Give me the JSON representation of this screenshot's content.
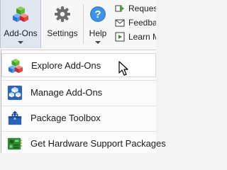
{
  "ribbon": {
    "addons_label": "Add-Ons",
    "settings_label": "Settings",
    "help_label": "Help",
    "small_items": [
      {
        "label": "Request",
        "icon": "request-support-icon"
      },
      {
        "label": "Feedback",
        "icon": "feedback-icon"
      },
      {
        "label": "Learn MATLAB",
        "icon": "learn-matlab-icon"
      }
    ]
  },
  "menu": {
    "items": [
      {
        "label": "Explore Add-Ons",
        "icon": "colored-cubes-icon"
      },
      {
        "label": "Manage Add-Ons",
        "icon": "manage-addons-icon"
      },
      {
        "label": "Package Toolbox",
        "icon": "package-toolbox-icon"
      },
      {
        "label": "Get Hardware Support Packages",
        "icon": "hardware-support-icon"
      }
    ]
  },
  "colors": {
    "addons_active_bg": "#dfe6ef",
    "menu_bg": "#fcfcfc",
    "ribbon_bg": "#f7f7f7"
  }
}
